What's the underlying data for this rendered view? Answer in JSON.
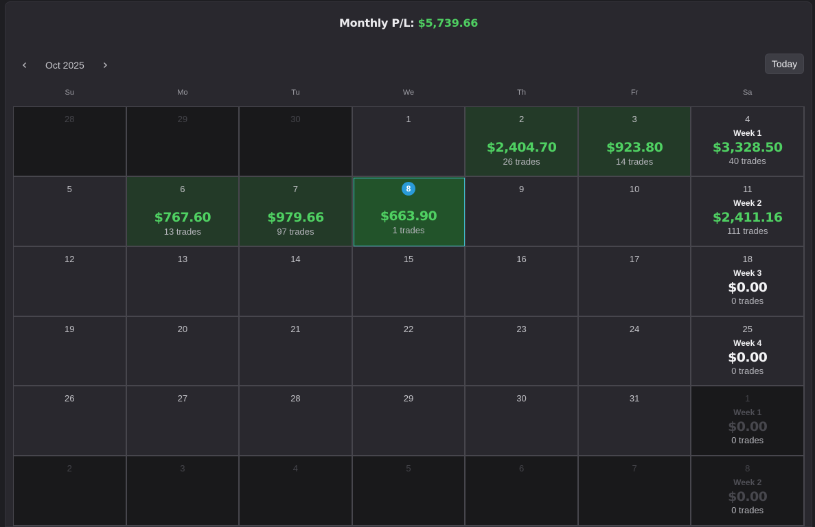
{
  "header": {
    "label": "Monthly P/L:",
    "amount": "$5,739.66"
  },
  "nav": {
    "prev_icon": "chevron-left-icon",
    "month": "Oct 2025",
    "next_icon": "chevron-right-icon",
    "today_label": "Today"
  },
  "weekdays": [
    "Su",
    "Mo",
    "Tu",
    "We",
    "Th",
    "Fr",
    "Sa"
  ],
  "colors": {
    "profit": "#4fd062",
    "today_badge": "#2a9bd8",
    "today_border": "#3fb7c6"
  },
  "weeks": [
    {
      "days": [
        {
          "day": "28",
          "outside": true
        },
        {
          "day": "29",
          "outside": true
        },
        {
          "day": "30",
          "outside": true
        },
        {
          "day": "1"
        },
        {
          "day": "2",
          "pnl": "$2,404.70",
          "trades": "26 trades"
        },
        {
          "day": "3",
          "pnl": "$923.80",
          "trades": "14 trades"
        }
      ],
      "summary": {
        "day": "4",
        "label": "Week 1",
        "pnl": "$3,328.50",
        "trades": "40 trades",
        "positive": true
      }
    },
    {
      "days": [
        {
          "day": "5"
        },
        {
          "day": "6",
          "pnl": "$767.60",
          "trades": "13 trades"
        },
        {
          "day": "7",
          "pnl": "$979.66",
          "trades": "97 trades"
        },
        {
          "day": "8",
          "pnl": "$663.90",
          "trades": "1 trades",
          "today": true
        },
        {
          "day": "9"
        },
        {
          "day": "10"
        }
      ],
      "summary": {
        "day": "11",
        "label": "Week 2",
        "pnl": "$2,411.16",
        "trades": "111 trades",
        "positive": true
      }
    },
    {
      "days": [
        {
          "day": "12"
        },
        {
          "day": "13"
        },
        {
          "day": "14"
        },
        {
          "day": "15"
        },
        {
          "day": "16"
        },
        {
          "day": "17"
        }
      ],
      "summary": {
        "day": "18",
        "label": "Week 3",
        "pnl": "$0.00",
        "trades": "0 trades"
      }
    },
    {
      "days": [
        {
          "day": "19"
        },
        {
          "day": "20"
        },
        {
          "day": "21"
        },
        {
          "day": "22"
        },
        {
          "day": "23"
        },
        {
          "day": "24"
        }
      ],
      "summary": {
        "day": "25",
        "label": "Week 4",
        "pnl": "$0.00",
        "trades": "0 trades"
      }
    },
    {
      "days": [
        {
          "day": "26"
        },
        {
          "day": "27"
        },
        {
          "day": "28"
        },
        {
          "day": "29"
        },
        {
          "day": "30"
        },
        {
          "day": "31"
        }
      ],
      "summary": {
        "day": "1",
        "label": "Week 1",
        "pnl": "$0.00",
        "trades": "0 trades",
        "outside": true
      }
    },
    {
      "days": [
        {
          "day": "2",
          "outside": true
        },
        {
          "day": "3",
          "outside": true
        },
        {
          "day": "4",
          "outside": true
        },
        {
          "day": "5",
          "outside": true
        },
        {
          "day": "6",
          "outside": true
        },
        {
          "day": "7",
          "outside": true
        }
      ],
      "summary": {
        "day": "8",
        "label": "Week 2",
        "pnl": "$0.00",
        "trades": "0 trades",
        "outside": true
      }
    }
  ]
}
